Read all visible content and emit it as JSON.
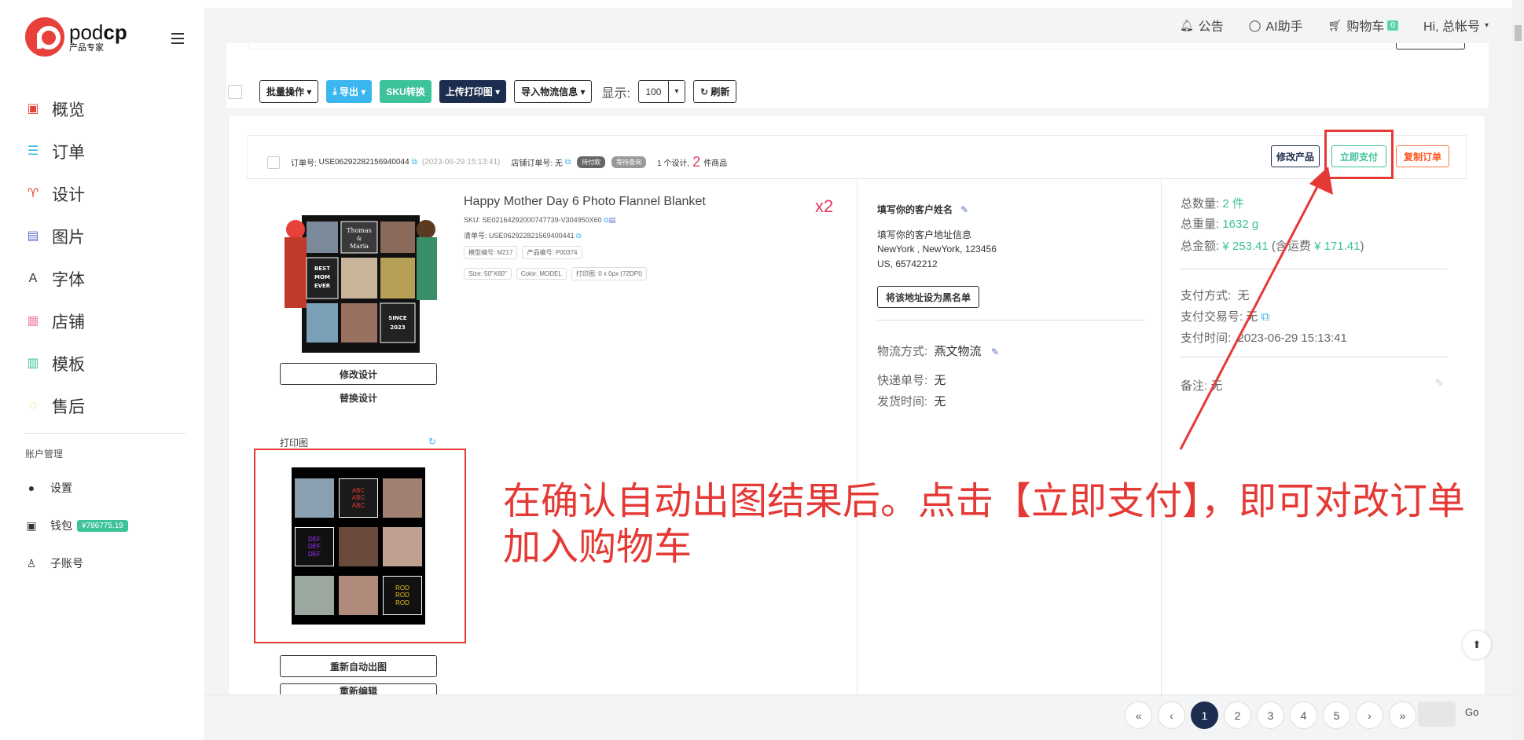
{
  "brand": {
    "name_light": "pod",
    "name_bold": "cp",
    "subtitle": "产品专家",
    "color": "#e8403a"
  },
  "nav": [
    {
      "label": "概览",
      "icon": "monitor-icon",
      "color": "#e8403a",
      "glyph": "▣"
    },
    {
      "label": "订单",
      "icon": "list-icon",
      "color": "#3bb6ef",
      "glyph": "☰"
    },
    {
      "label": "设计",
      "icon": "shirt-icon",
      "color": "#e8403a",
      "glyph": "♈"
    },
    {
      "label": "图片",
      "icon": "image-icon",
      "color": "#5a6fc8",
      "glyph": "▤"
    },
    {
      "label": "字体",
      "icon": "font-icon",
      "color": "#333",
      "glyph": "A"
    },
    {
      "label": "店铺",
      "icon": "store-icon",
      "color": "#f08aa8",
      "glyph": "▦"
    },
    {
      "label": "模板",
      "icon": "template-icon",
      "color": "#3dc29a",
      "glyph": "▥"
    },
    {
      "label": "售后",
      "icon": "chat-icon",
      "color": "#f0c020",
      "glyph": "◌"
    }
  ],
  "account": {
    "title": "账户管理",
    "settings": "设置",
    "wallet": "钱包",
    "wallet_balance": "¥786775.19",
    "sub_accounts": "子账号"
  },
  "topbar": {
    "notice": "公告",
    "ai": "AI助手",
    "cart": "购物车",
    "cart_count": "0",
    "user": "Hi, 总帐号"
  },
  "toolbar": {
    "batch": "批量操作",
    "export": "导出",
    "sku": "SKU转换",
    "upload_print": "上传打印图",
    "import_logistics": "导入物流信息",
    "display_label": "显示:",
    "page_size": "100",
    "refresh": "刷新"
  },
  "order": {
    "no_label": "订单号:",
    "no": "USE06292282156940044",
    "time": "(2023-06-29 15:13:41)",
    "store_no_label": "店铺订单号:",
    "store_no": "无",
    "tag1": "待付款",
    "tag2": "等待查询",
    "design_count": "1 个设计,",
    "item_count": "2",
    "item_suffix": "件商品",
    "btn_edit_product": "修改产品",
    "btn_pay": "立即支付",
    "btn_copy": "复制订单",
    "product_title": "Happy Mother Day 6 Photo Flannel Blanket",
    "qty": "x2",
    "sku": "SKU: SE02164292000747739-V304950X60",
    "list_no": "清单号: USE062922821569400441",
    "model_no": "模型编号: M217",
    "product_no": "产品编号: P00374",
    "size": "Size: 50\"X60\"",
    "color": "Color: MODEL",
    "print_size": "打印图: 0 x 0px (72DPI)",
    "btn_edit_design": "修改设计",
    "btn_replace_design": "替换设计",
    "print_label": "打印图",
    "btn_regen": "重新自动出图",
    "btn_reedit": "重新编辑",
    "customer_name": "填写你的客户姓名",
    "customer_addr": "填写你的客户地址信息",
    "addr_line1": "NewYork , NewYork, 123456",
    "addr_line2": "US, 65742212",
    "btn_blacklist": "将该地址设为黑名单",
    "ship_method_label": "物流方式:",
    "ship_method": "燕文物流",
    "tracking_label": "快递单号:",
    "tracking": "无",
    "ship_time_label": "发货时间:",
    "ship_time": "无",
    "total_qty_label": "总数量:",
    "total_qty": "2 件",
    "total_weight_label": "总重量:",
    "total_weight": "1632 g",
    "total_amount_label": "总金额:",
    "total_amount": "¥ 253.41",
    "freight_label": "(含运费",
    "freight": "¥ 171.41",
    "freight_close": ")",
    "pay_method_label": "支付方式:",
    "pay_method": "无",
    "pay_txn_label": "支付交易号:",
    "pay_txn": "无",
    "pay_time_label": "支付时间:",
    "pay_time": "2023-06-29 15:13:41",
    "remark_label": "备注:",
    "remark": "无"
  },
  "print_cells": [
    "ABC",
    "ABC",
    "ABC",
    "DEF",
    "DEF",
    "DEF",
    "ROD",
    "ROD",
    "ROD"
  ],
  "annotation": "在确认自动出图结果后。点击【立即支付】，即可对改订单加入购物车",
  "blanket_text": {
    "t1": "Thomas",
    "t2": "&",
    "t3": "Maria",
    "b1": "BEST",
    "b2": "MOM",
    "b3": "EVER",
    "s1": "SINCE",
    "s2": "2023"
  },
  "pagination": {
    "first": "«",
    "prev": "‹",
    "pages": [
      "1",
      "2",
      "3",
      "4",
      "5"
    ],
    "next": "›",
    "last": "»",
    "go": "Go",
    "current": "1"
  }
}
